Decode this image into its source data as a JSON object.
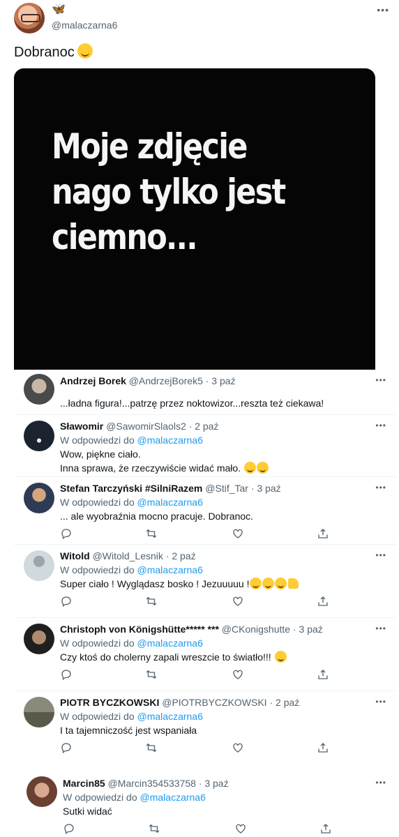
{
  "post": {
    "handle": "@malaczarna6",
    "badge": "🦋",
    "more": "•••",
    "text": "Dobranoc",
    "image_text": "Moje zdjęcie\nnago tylko jest\nciemno..."
  },
  "reply_prefix": "W odpowiedzi do",
  "replies": [
    {
      "name": "Andrzej Borek",
      "handle": "@AndrzejBorek5",
      "date": "· 3 paź",
      "reply_to": "",
      "text": "...ładna figura!...patrzę przez noktowizor...reszta też ciekawa!",
      "avatar": "#3a3a3a"
    },
    {
      "name": "Sławomir",
      "handle": "@SawomirSlaols2",
      "date": "· 2 paź",
      "reply_to": "@malaczarna6",
      "text": "Wow, piękne ciało.\nInna sprawa, że rzeczywiście widać mało.",
      "avatar": "#1b2330"
    },
    {
      "name": "Stefan Tarczyński #SilniRazem",
      "handle": "@Stif_Tar",
      "date": "· 3 paź",
      "reply_to": "@malaczarna6",
      "text": "... ale wyobraźnia mocno pracuje. Dobranoc.",
      "avatar": "#5a2a1a"
    },
    {
      "name": "Witold",
      "handle": "@Witold_Lesnik",
      "date": "· 2 paź",
      "reply_to": "@malaczarna6",
      "text": "Super ciało ! Wyglądasz bosko ! Jezuuuuu !",
      "avatar": "#cfd9de"
    },
    {
      "name": "Christoph von Königshütte***** ***",
      "handle": "@CKonigshutte",
      "date": "· 3 paź",
      "reply_to": "@malaczarna6",
      "text": "Czy ktoś do cholerny zapali wreszcie to światło!!!",
      "avatar": "#2a2a2a"
    },
    {
      "name": "PIOTR BYCZKOWSKI",
      "handle": "@PIOTRBYCZKOWSKI",
      "date": "· 2 paź",
      "reply_to": "@malaczarna6",
      "text": "I ta tajemniczość jest wspaniała",
      "avatar": "#6b6b5a"
    },
    {
      "name": "Marcin85",
      "handle": "@Marcin354533758",
      "date": "· 3 paź",
      "reply_to": "@malaczarna6",
      "text": "Sutki widać",
      "avatar": "#8a6a5a"
    }
  ]
}
